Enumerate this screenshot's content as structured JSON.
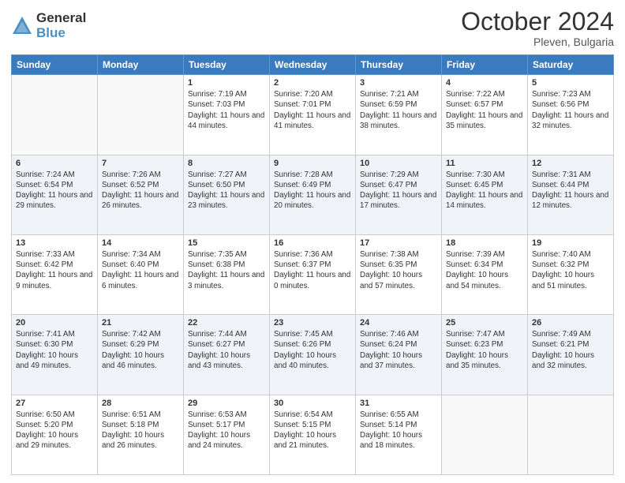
{
  "header": {
    "logo_general": "General",
    "logo_blue": "Blue",
    "month_title": "October 2024",
    "location": "Pleven, Bulgaria"
  },
  "days_of_week": [
    "Sunday",
    "Monday",
    "Tuesday",
    "Wednesday",
    "Thursday",
    "Friday",
    "Saturday"
  ],
  "weeks": [
    [
      {
        "day": "",
        "content": ""
      },
      {
        "day": "",
        "content": ""
      },
      {
        "day": "1",
        "content": "Sunrise: 7:19 AM\nSunset: 7:03 PM\nDaylight: 11 hours and 44 minutes."
      },
      {
        "day": "2",
        "content": "Sunrise: 7:20 AM\nSunset: 7:01 PM\nDaylight: 11 hours and 41 minutes."
      },
      {
        "day": "3",
        "content": "Sunrise: 7:21 AM\nSunset: 6:59 PM\nDaylight: 11 hours and 38 minutes."
      },
      {
        "day": "4",
        "content": "Sunrise: 7:22 AM\nSunset: 6:57 PM\nDaylight: 11 hours and 35 minutes."
      },
      {
        "day": "5",
        "content": "Sunrise: 7:23 AM\nSunset: 6:56 PM\nDaylight: 11 hours and 32 minutes."
      }
    ],
    [
      {
        "day": "6",
        "content": "Sunrise: 7:24 AM\nSunset: 6:54 PM\nDaylight: 11 hours and 29 minutes."
      },
      {
        "day": "7",
        "content": "Sunrise: 7:26 AM\nSunset: 6:52 PM\nDaylight: 11 hours and 26 minutes."
      },
      {
        "day": "8",
        "content": "Sunrise: 7:27 AM\nSunset: 6:50 PM\nDaylight: 11 hours and 23 minutes."
      },
      {
        "day": "9",
        "content": "Sunrise: 7:28 AM\nSunset: 6:49 PM\nDaylight: 11 hours and 20 minutes."
      },
      {
        "day": "10",
        "content": "Sunrise: 7:29 AM\nSunset: 6:47 PM\nDaylight: 11 hours and 17 minutes."
      },
      {
        "day": "11",
        "content": "Sunrise: 7:30 AM\nSunset: 6:45 PM\nDaylight: 11 hours and 14 minutes."
      },
      {
        "day": "12",
        "content": "Sunrise: 7:31 AM\nSunset: 6:44 PM\nDaylight: 11 hours and 12 minutes."
      }
    ],
    [
      {
        "day": "13",
        "content": "Sunrise: 7:33 AM\nSunset: 6:42 PM\nDaylight: 11 hours and 9 minutes."
      },
      {
        "day": "14",
        "content": "Sunrise: 7:34 AM\nSunset: 6:40 PM\nDaylight: 11 hours and 6 minutes."
      },
      {
        "day": "15",
        "content": "Sunrise: 7:35 AM\nSunset: 6:38 PM\nDaylight: 11 hours and 3 minutes."
      },
      {
        "day": "16",
        "content": "Sunrise: 7:36 AM\nSunset: 6:37 PM\nDaylight: 11 hours and 0 minutes."
      },
      {
        "day": "17",
        "content": "Sunrise: 7:38 AM\nSunset: 6:35 PM\nDaylight: 10 hours and 57 minutes."
      },
      {
        "day": "18",
        "content": "Sunrise: 7:39 AM\nSunset: 6:34 PM\nDaylight: 10 hours and 54 minutes."
      },
      {
        "day": "19",
        "content": "Sunrise: 7:40 AM\nSunset: 6:32 PM\nDaylight: 10 hours and 51 minutes."
      }
    ],
    [
      {
        "day": "20",
        "content": "Sunrise: 7:41 AM\nSunset: 6:30 PM\nDaylight: 10 hours and 49 minutes."
      },
      {
        "day": "21",
        "content": "Sunrise: 7:42 AM\nSunset: 6:29 PM\nDaylight: 10 hours and 46 minutes."
      },
      {
        "day": "22",
        "content": "Sunrise: 7:44 AM\nSunset: 6:27 PM\nDaylight: 10 hours and 43 minutes."
      },
      {
        "day": "23",
        "content": "Sunrise: 7:45 AM\nSunset: 6:26 PM\nDaylight: 10 hours and 40 minutes."
      },
      {
        "day": "24",
        "content": "Sunrise: 7:46 AM\nSunset: 6:24 PM\nDaylight: 10 hours and 37 minutes."
      },
      {
        "day": "25",
        "content": "Sunrise: 7:47 AM\nSunset: 6:23 PM\nDaylight: 10 hours and 35 minutes."
      },
      {
        "day": "26",
        "content": "Sunrise: 7:49 AM\nSunset: 6:21 PM\nDaylight: 10 hours and 32 minutes."
      }
    ],
    [
      {
        "day": "27",
        "content": "Sunrise: 6:50 AM\nSunset: 5:20 PM\nDaylight: 10 hours and 29 minutes."
      },
      {
        "day": "28",
        "content": "Sunrise: 6:51 AM\nSunset: 5:18 PM\nDaylight: 10 hours and 26 minutes."
      },
      {
        "day": "29",
        "content": "Sunrise: 6:53 AM\nSunset: 5:17 PM\nDaylight: 10 hours and 24 minutes."
      },
      {
        "day": "30",
        "content": "Sunrise: 6:54 AM\nSunset: 5:15 PM\nDaylight: 10 hours and 21 minutes."
      },
      {
        "day": "31",
        "content": "Sunrise: 6:55 AM\nSunset: 5:14 PM\nDaylight: 10 hours and 18 minutes."
      },
      {
        "day": "",
        "content": ""
      },
      {
        "day": "",
        "content": ""
      }
    ]
  ]
}
